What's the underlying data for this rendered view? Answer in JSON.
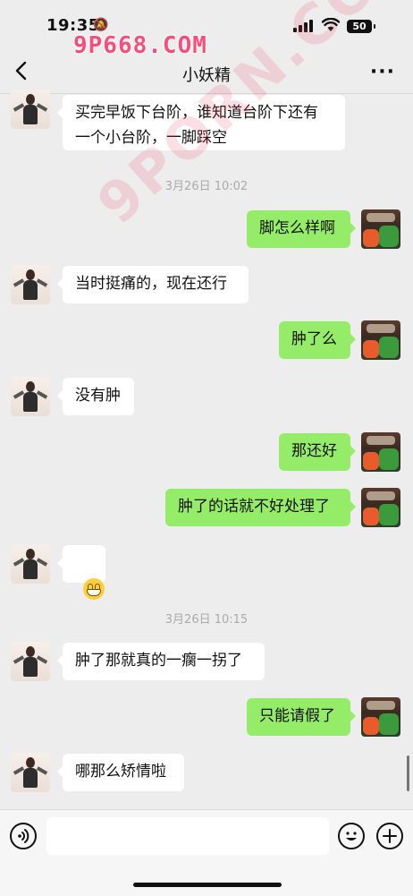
{
  "status": {
    "time": "19:35",
    "battery": "50"
  },
  "watermarks": {
    "top": "9P668.COM",
    "diag": "9PORN.COM"
  },
  "nav": {
    "title": "小妖精"
  },
  "messages": [
    {
      "text": "买完早饭下台阶，谁知道台阶下还有\n一个小台阶，一脚踩空"
    },
    {
      "time": "3月26日 10:02"
    },
    {
      "text": "脚怎么样啊"
    },
    {
      "text": "当时挺痛的，现在还行"
    },
    {
      "text": "肿了么"
    },
    {
      "text": "没有肿"
    },
    {
      "text": "那还好"
    },
    {
      "text": "肿了的话就不好处理了"
    },
    {
      "emoji": "grin-emoji"
    },
    {
      "time": "3月26日 10:15"
    },
    {
      "text": "肿了那就真的一瘸一拐了"
    },
    {
      "text": "只能请假了"
    },
    {
      "text": "哪那么矫情啦"
    }
  ],
  "colors": {
    "outgoing": "#95ec69",
    "incoming": "#ffffff",
    "background": "#ededed"
  }
}
